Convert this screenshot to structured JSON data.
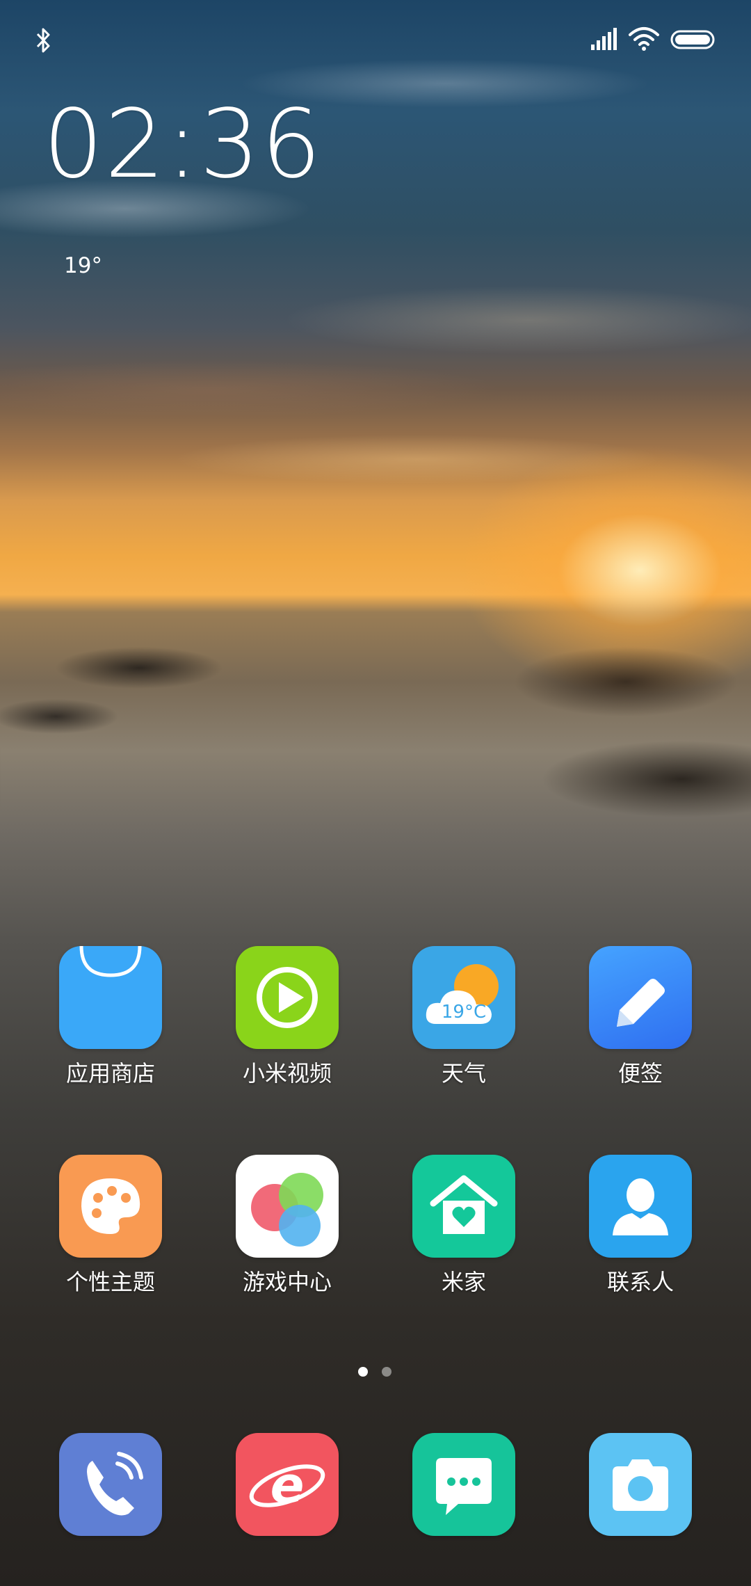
{
  "status_bar": {
    "icons": [
      "bluetooth-icon",
      "signal-icon",
      "wifi-icon",
      "battery-icon"
    ]
  },
  "clock": {
    "time": "02:36"
  },
  "weather": {
    "temperature": "19°"
  },
  "apps": {
    "row1": [
      {
        "label": "应用商店",
        "icon": "app-store-icon",
        "color": "#3aa8f8"
      },
      {
        "label": "小米视频",
        "icon": "video-play-icon",
        "color": "#8ad41a"
      },
      {
        "label": "天气",
        "icon": "weather-icon",
        "color": "#3aa6e6",
        "badge": "19°C"
      },
      {
        "label": "便签",
        "icon": "notes-icon",
        "color": "#3b82f6"
      }
    ],
    "row2": [
      {
        "label": "个性主题",
        "icon": "palette-icon",
        "color": "#f99a52"
      },
      {
        "label": "游戏中心",
        "icon": "game-center-icon",
        "color": "#ffffff"
      },
      {
        "label": "米家",
        "icon": "home-heart-icon",
        "color": "#14c89a"
      },
      {
        "label": "联系人",
        "icon": "contacts-icon",
        "color": "#2aa4ee"
      }
    ],
    "dock": [
      {
        "icon": "phone-icon",
        "color": "#5f7fd4"
      },
      {
        "icon": "browser-icon",
        "color": "#f2555f"
      },
      {
        "icon": "messages-icon",
        "color": "#16c49a"
      },
      {
        "icon": "camera-icon",
        "color": "#5cc3f3"
      }
    ]
  },
  "page_indicator": {
    "pages": 2,
    "current": 1
  }
}
